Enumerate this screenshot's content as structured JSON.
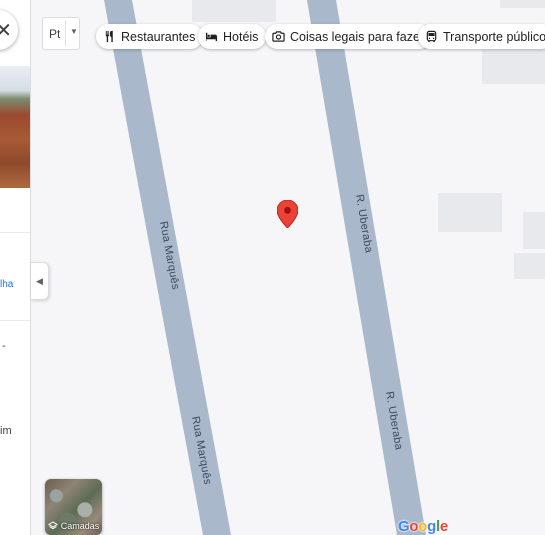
{
  "map": {
    "streets": [
      {
        "name": "Rua Marquês",
        "label_text": "Rua Marquês"
      },
      {
        "name": "R. Uberaba",
        "label_text": "R. Uberaba"
      }
    ]
  },
  "side_panel": {
    "back_icon": "close-icon",
    "text_line_1": "lha",
    "text_line_2": "-",
    "text_line_3": "im"
  },
  "language_button": {
    "label": "Pt"
  },
  "chips": [
    {
      "label": "Restaurantes",
      "icon": "fork-knife-icon"
    },
    {
      "label": "Hotéis",
      "icon": "bed-icon"
    },
    {
      "label": "Coisas legais para fazer",
      "icon": "camera-icon"
    },
    {
      "label": "Transporte público",
      "icon": "bus-icon"
    }
  ],
  "layers": {
    "label": "Camadas"
  },
  "colors": {
    "road": "#aab8cc",
    "building": "#e8e9ed",
    "marker": "#ea4335"
  }
}
